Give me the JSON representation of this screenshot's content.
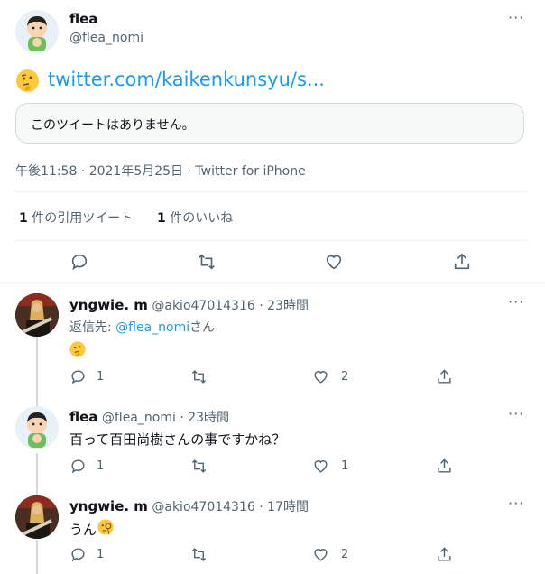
{
  "main_tweet": {
    "author_name": "flea",
    "author_handle": "@flea_nomi",
    "emoji": "thinking-face",
    "link_text": "twitter.com/kaikenkunsyu/s...",
    "quoted_unavailable": "このツイートはありません。",
    "meta": "午後11:58 · 2021年5月25日 · Twitter for iPhone",
    "quote_count": "1",
    "quote_label": " 件の引用ツイート",
    "like_count": "1",
    "like_label": " 件のいいね"
  },
  "replies": [
    {
      "author_name": "yngwie. m",
      "author_handle": "@akio47014316",
      "time": "· 23時間",
      "reply_to_prefix": "返信先: ",
      "reply_to_handle": "@flea_nomi",
      "reply_to_suffix": "さん",
      "emoji": "thinking-face",
      "reply_count": "1",
      "retweet_count": "",
      "like_count": "2"
    },
    {
      "author_name": "flea",
      "author_handle": "@flea_nomi",
      "time": "· 23時間",
      "text": "百って百田尚樹さんの事ですかね？",
      "reply_count": "1",
      "retweet_count": "",
      "like_count": "1"
    },
    {
      "author_name": "yngwie. m",
      "author_handle": "@akio47014316",
      "time": "· 17時間",
      "text": "うん",
      "emoji": "face-with-monocle",
      "reply_count": "1",
      "retweet_count": "",
      "like_count": "2"
    }
  ],
  "more_glyph": "···",
  "colors": {
    "accent": "#1d9bf0",
    "muted": "#536471",
    "border": "#eff3f4"
  }
}
